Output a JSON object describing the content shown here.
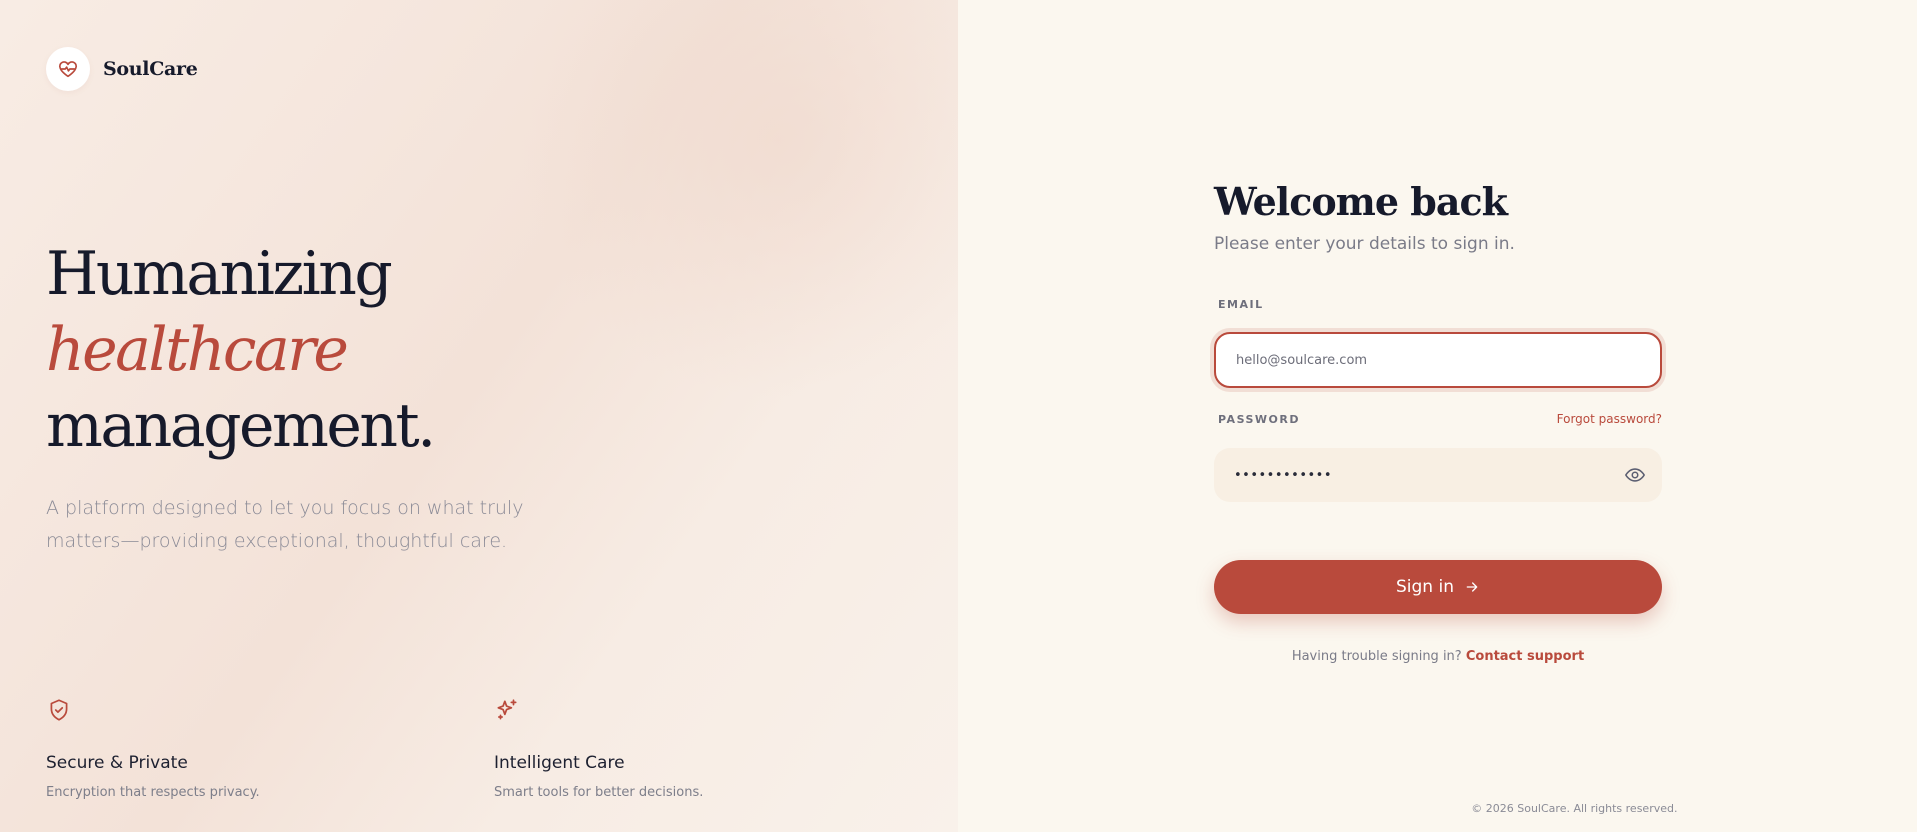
{
  "brand": {
    "name": "SoulCare",
    "logo_icon": "heart-pulse-icon"
  },
  "hero": {
    "line1": "Humanizing",
    "line2": "healthcare",
    "line3": "management.",
    "subtitle": "A platform designed to let you focus on what truly matters—providing exceptional, thoughtful care."
  },
  "features": [
    {
      "icon": "shield-check-icon",
      "title": "Secure & Private",
      "description": "Encryption that respects privacy."
    },
    {
      "icon": "sparkles-icon",
      "title": "Intelligent Care",
      "description": "Smart tools for better decisions."
    }
  ],
  "form": {
    "title": "Welcome back",
    "subtitle": "Please enter your details to sign in.",
    "email_label": "EMAIL",
    "email_placeholder": "hello@soulcare.com",
    "password_label": "PASSWORD",
    "forgot_label": "Forgot password?",
    "password_value": "••••••••••••",
    "signin_label": "Sign in",
    "trouble_text": "Having trouble signing in?",
    "support_link": "Contact support"
  },
  "footer": {
    "copyright": "© 2026 SoulCare. All rights reserved."
  },
  "colors": {
    "accent": "#b94a3c",
    "ink": "#161a2b",
    "left_bg": "#f5e6dd",
    "right_bg": "#fbf7ef"
  }
}
